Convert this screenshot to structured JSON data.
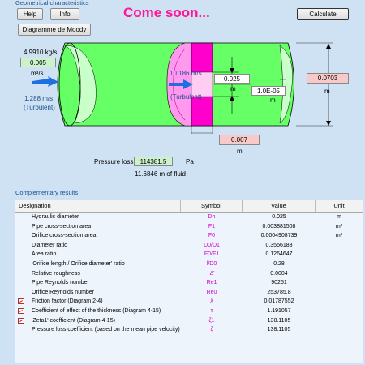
{
  "header": {
    "section_title": "Geometrical characteristics",
    "help_label": "Help",
    "info_label": "Info",
    "moody_label": "Diagramme de Moody",
    "come_soon": "Come soon...",
    "calculate_label": "Calculate"
  },
  "diagram": {
    "mass_flow": "4.9910 kg/s",
    "volume_flow": "0.005",
    "volume_unit": "m³/s",
    "pipe_velocity": "1.288 m/s",
    "pipe_regime": "(Turbulent)",
    "orifice_velocity": "10.186 m/s",
    "orifice_regime": "(Turbulent)",
    "orifice_diameter": "0.025",
    "orifice_diameter_unit": "m",
    "roughness": "1.0E-05",
    "roughness_unit": "m",
    "pipe_diameter": "0.0703",
    "pipe_diameter_unit": "m",
    "orifice_length": "0.007",
    "orifice_length_unit": "m"
  },
  "pressure": {
    "label": "Pressure loss",
    "value": "114381.5",
    "unit": "Pa",
    "fluid": "11.6846 m of fluid"
  },
  "results": {
    "title": "Complementary results",
    "headers": [
      "Designation",
      "Symbol",
      "Value",
      "Unit"
    ],
    "rows": [
      {
        "designation": "Hydraulic diameter",
        "symbol": "Dh",
        "value": "0.025",
        "unit": "m",
        "icon": false
      },
      {
        "designation": "Pipe cross-section area",
        "symbol": "F1",
        "value": "0.003881508",
        "unit": "m²",
        "icon": false
      },
      {
        "designation": "Orifice cross-section area",
        "symbol": "F0",
        "value": "0.0004908739",
        "unit": "m²",
        "icon": false
      },
      {
        "designation": "Diameter ratio",
        "symbol": "D0/D1",
        "value": "0.3556188",
        "unit": "",
        "icon": false
      },
      {
        "designation": "Area ratio",
        "symbol": "F0/F1",
        "value": "0.1264647",
        "unit": "",
        "icon": false
      },
      {
        "designation": "'Orifice length / Orifice diameter' ratio",
        "symbol": "l/D0",
        "value": "0.28",
        "unit": "",
        "icon": false
      },
      {
        "designation": "Relative roughness",
        "symbol": "Δ̄",
        "value": "0.0004",
        "unit": "",
        "icon": false
      },
      {
        "designation": "Pipe Reynolds number",
        "symbol": "Re1",
        "value": "90251",
        "unit": "",
        "icon": false
      },
      {
        "designation": "Orifice Reynolds number",
        "symbol": "Re0",
        "value": "253785.8",
        "unit": "",
        "icon": false
      },
      {
        "designation": "Friction factor (Diagram 2-4)",
        "symbol": "λ",
        "value": "0.01787552",
        "unit": "",
        "icon": true
      },
      {
        "designation": "Coefficient of effect of the thickness (Diagram 4-15)",
        "symbol": "τ",
        "value": "1.191057",
        "unit": "",
        "icon": true
      },
      {
        "designation": "'Zeta1' coefficient (Diagram 4-15)",
        "symbol": "ζ1",
        "value": "138.1105",
        "unit": "",
        "icon": true
      },
      {
        "designation": "Pressure loss coefficient (based on the mean pipe velocity)",
        "symbol": "ζ",
        "value": "138.1105",
        "unit": "",
        "icon": false
      }
    ]
  },
  "colors": {
    "pipe": "#66ff66",
    "orifice": "#ff00cc",
    "title": "#ff1493",
    "arrow": "#1e6fe0"
  }
}
